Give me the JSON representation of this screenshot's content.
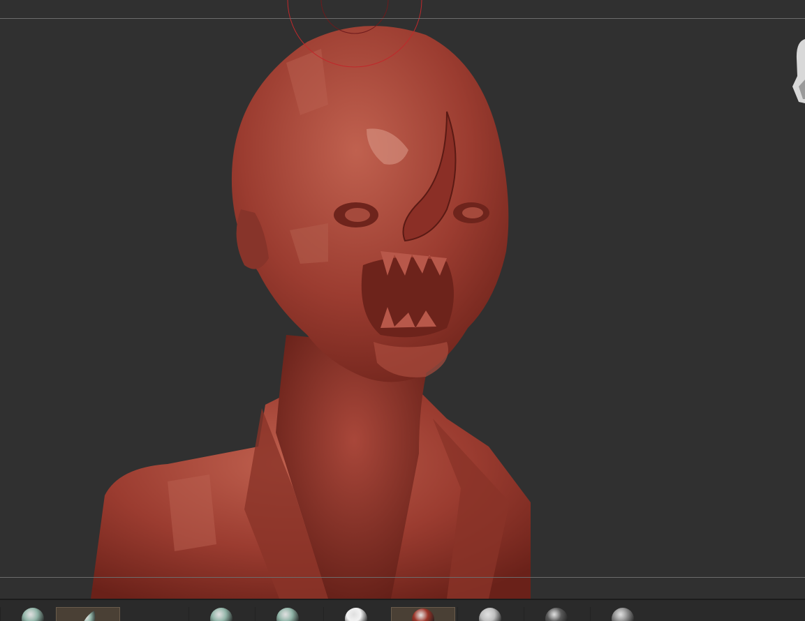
{
  "viewport": {
    "background": "#303030",
    "guide_color": "#6d6d6d",
    "brush_cursor_color": "#c0282b",
    "model_color": "#9b3c30"
  },
  "navigation_cube": {
    "icon": "head-navigation-icon"
  },
  "shelf": {
    "slots": [
      {
        "kind": "brush",
        "icon": "sculpt-brush-icon",
        "color": "#8fb3a6",
        "selected": false
      },
      {
        "kind": "brush",
        "icon": "claybuildup-brush-icon",
        "color": "#8fb3a6",
        "selected": true
      },
      {
        "kind": "brush",
        "icon": "smooth-brush-icon",
        "color": "#8fb3a6",
        "selected": false
      },
      {
        "kind": "brush",
        "icon": "alpha-brush-icon",
        "color": "#8fb3a6",
        "selected": false
      },
      {
        "kind": "material",
        "icon": "white-material-icon",
        "color": "#f2f2f2",
        "selected": false
      },
      {
        "kind": "material",
        "icon": "red-wax-material-icon",
        "color": "#9a3428",
        "selected": true
      },
      {
        "kind": "material",
        "icon": "chrome-material-icon",
        "color": "#bdbdbd",
        "selected": false
      },
      {
        "kind": "material",
        "icon": "dark-material-icon",
        "color": "#5a5a5a",
        "selected": false
      },
      {
        "kind": "material",
        "icon": "gray-material-icon",
        "color": "#8c8c8c",
        "selected": false
      }
    ]
  }
}
